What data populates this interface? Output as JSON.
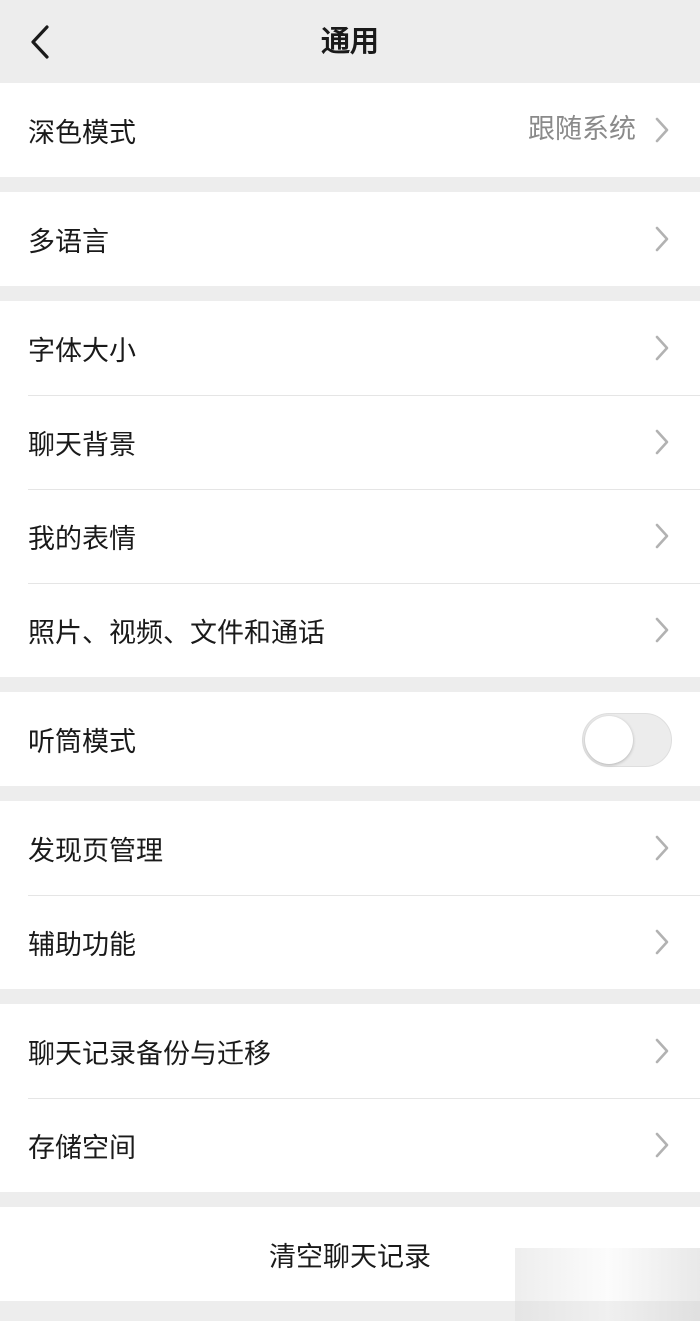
{
  "header": {
    "title": "通用",
    "back_icon": "chevron-left-icon"
  },
  "groups": [
    {
      "items": [
        {
          "label": "深色模式",
          "value": "跟随系统"
        }
      ]
    },
    {
      "items": [
        {
          "label": "多语言"
        }
      ]
    },
    {
      "items": [
        {
          "label": "字体大小"
        },
        {
          "label": "聊天背景"
        },
        {
          "label": "我的表情"
        },
        {
          "label": "照片、视频、文件和通话"
        }
      ]
    },
    {
      "items": [
        {
          "label": "听筒模式",
          "toggle": false
        }
      ]
    },
    {
      "items": [
        {
          "label": "发现页管理"
        },
        {
          "label": "辅助功能"
        }
      ]
    },
    {
      "items": [
        {
          "label": "聊天记录备份与迁移"
        },
        {
          "label": "存储空间"
        }
      ]
    }
  ],
  "clear_chat": {
    "label": "清空聊天记录"
  },
  "colors": {
    "background": "#ededed",
    "card": "#ffffff",
    "text": "#1a1a1a",
    "secondary_text": "#8a8a8a",
    "chevron": "#b2b2b2"
  }
}
